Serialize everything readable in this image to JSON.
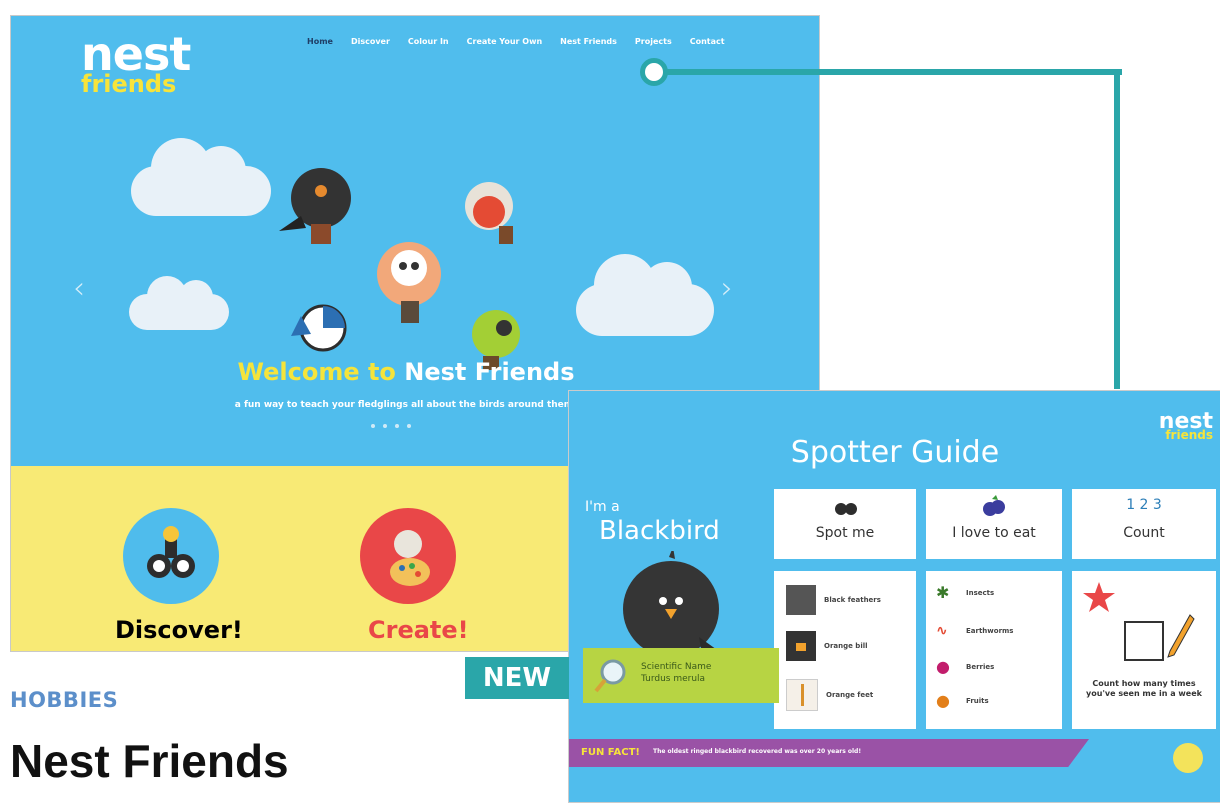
{
  "site": {
    "logo": {
      "line1": "nest",
      "line2": "friends"
    },
    "nav": [
      "Home",
      "Discover",
      "Colour In",
      "Create Your Own",
      "Nest Friends",
      "Projects",
      "Contact"
    ],
    "hero": {
      "title_part1": "Welcome to ",
      "title_part2": "Nest Friends",
      "subtitle": "a fun way to teach your fledglings all about the birds around them!",
      "prev": "‹",
      "next": "›"
    },
    "features": [
      {
        "label": "Discover!",
        "color": "#444444"
      },
      {
        "label": "Create!",
        "color": "#e94748"
      }
    ]
  },
  "guide": {
    "title": "Spotter Guide",
    "logo": {
      "line1": "nest",
      "line2": "friends"
    },
    "im_a": "I'm a",
    "bird_name": "Blackbird",
    "cards": [
      {
        "label": "Spot me"
      },
      {
        "label": "I love to eat"
      },
      {
        "label": "Count",
        "superscript": "1 2 3"
      }
    ],
    "spot_features": [
      "Black feathers",
      "Orange bill",
      "Orange feet"
    ],
    "foods": [
      "Insects",
      "Earthworms",
      "Berries",
      "Fruits"
    ],
    "count_text": "Count how many times you've seen me in a week",
    "scientific_name": {
      "line1": "Scientific Name",
      "line2": "Turdus merula"
    },
    "fun_fact_label": "FUN FACT!",
    "fun_fact_text": "The oldest ringed blackbird recovered was over 20 years old!"
  },
  "badge": {
    "text": "NEW"
  },
  "category": "HOBBIES",
  "title": "Nest Friends",
  "colors": {
    "sky": "#50bded",
    "accent_teal": "#2aa6a9",
    "category_blue": "#5c8fca",
    "yellow_band": "#f8ea75"
  }
}
